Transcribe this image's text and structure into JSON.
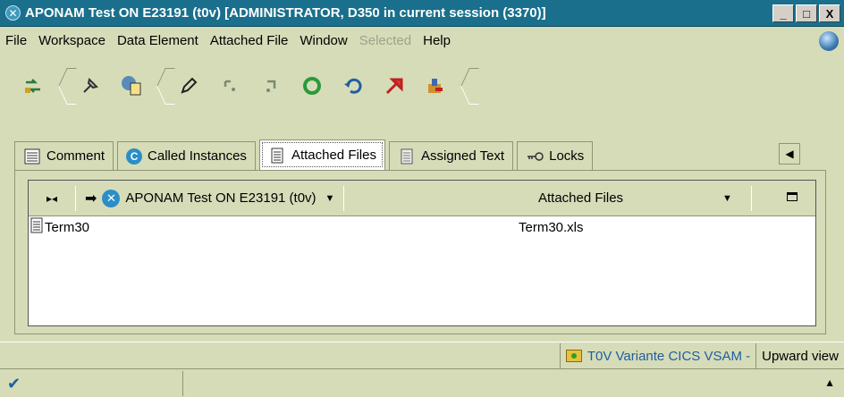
{
  "window": {
    "title": "APONAM Test ON E23191 (t0v) [ADMINISTRATOR, D350 in current session (3370)]",
    "buttons": {
      "minimize": "_",
      "maximize": "□",
      "close": "X"
    }
  },
  "menu": [
    {
      "label": "File",
      "enabled": true
    },
    {
      "label": "Workspace",
      "enabled": true
    },
    {
      "label": "Data Element",
      "enabled": true
    },
    {
      "label": "Attached File",
      "enabled": true
    },
    {
      "label": "Window",
      "enabled": true
    },
    {
      "label": "Selected",
      "enabled": false
    },
    {
      "label": "Help",
      "enabled": true
    }
  ],
  "toolbar": {
    "icons": [
      "refresh-icon",
      "pin-icon",
      "upload-icon",
      "edit-icon",
      "expand-icon",
      "collapse-icon",
      "recycle-icon",
      "undo-icon",
      "red-arrow-icon",
      "tools-icon"
    ]
  },
  "tabs": [
    {
      "label": "Comment",
      "active": false
    },
    {
      "label": "Called Instances",
      "active": false
    },
    {
      "label": "Attached Files",
      "active": true
    },
    {
      "label": "Assigned Text",
      "active": false
    },
    {
      "label": "Locks",
      "active": false
    }
  ],
  "grid": {
    "header": {
      "instance": "APONAM Test ON E23191 (t0v)",
      "column": "Attached Files"
    },
    "rows": [
      {
        "name": "Term30",
        "file": "Term30.xls"
      }
    ]
  },
  "status": {
    "link": "T0V Variante CICS VSAM -",
    "view": "Upward view"
  },
  "colors": {
    "titlebar": "#1a6f8c",
    "background": "#d6dcb8",
    "link": "#1f5fa0"
  }
}
